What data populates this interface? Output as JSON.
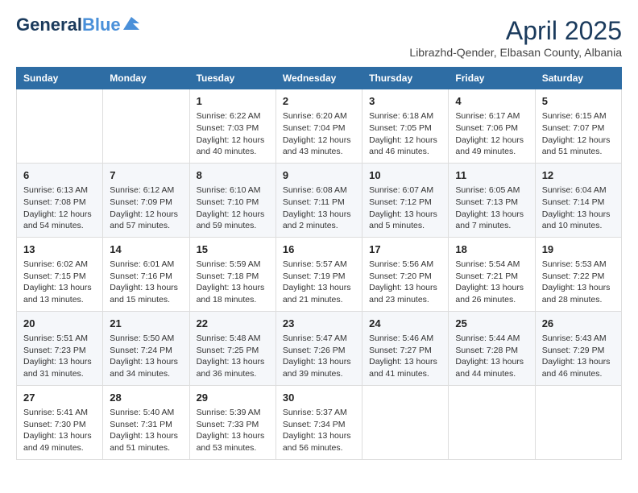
{
  "header": {
    "logo_general": "General",
    "logo_blue": "Blue",
    "month_year": "April 2025",
    "location": "Librazhd-Qender, Elbasan County, Albania"
  },
  "days_of_week": [
    "Sunday",
    "Monday",
    "Tuesday",
    "Wednesday",
    "Thursday",
    "Friday",
    "Saturday"
  ],
  "weeks": [
    [
      {
        "day": "",
        "content": ""
      },
      {
        "day": "",
        "content": ""
      },
      {
        "day": "1",
        "content": "Sunrise: 6:22 AM\nSunset: 7:03 PM\nDaylight: 12 hours and 40 minutes."
      },
      {
        "day": "2",
        "content": "Sunrise: 6:20 AM\nSunset: 7:04 PM\nDaylight: 12 hours and 43 minutes."
      },
      {
        "day": "3",
        "content": "Sunrise: 6:18 AM\nSunset: 7:05 PM\nDaylight: 12 hours and 46 minutes."
      },
      {
        "day": "4",
        "content": "Sunrise: 6:17 AM\nSunset: 7:06 PM\nDaylight: 12 hours and 49 minutes."
      },
      {
        "day": "5",
        "content": "Sunrise: 6:15 AM\nSunset: 7:07 PM\nDaylight: 12 hours and 51 minutes."
      }
    ],
    [
      {
        "day": "6",
        "content": "Sunrise: 6:13 AM\nSunset: 7:08 PM\nDaylight: 12 hours and 54 minutes."
      },
      {
        "day": "7",
        "content": "Sunrise: 6:12 AM\nSunset: 7:09 PM\nDaylight: 12 hours and 57 minutes."
      },
      {
        "day": "8",
        "content": "Sunrise: 6:10 AM\nSunset: 7:10 PM\nDaylight: 12 hours and 59 minutes."
      },
      {
        "day": "9",
        "content": "Sunrise: 6:08 AM\nSunset: 7:11 PM\nDaylight: 13 hours and 2 minutes."
      },
      {
        "day": "10",
        "content": "Sunrise: 6:07 AM\nSunset: 7:12 PM\nDaylight: 13 hours and 5 minutes."
      },
      {
        "day": "11",
        "content": "Sunrise: 6:05 AM\nSunset: 7:13 PM\nDaylight: 13 hours and 7 minutes."
      },
      {
        "day": "12",
        "content": "Sunrise: 6:04 AM\nSunset: 7:14 PM\nDaylight: 13 hours and 10 minutes."
      }
    ],
    [
      {
        "day": "13",
        "content": "Sunrise: 6:02 AM\nSunset: 7:15 PM\nDaylight: 13 hours and 13 minutes."
      },
      {
        "day": "14",
        "content": "Sunrise: 6:01 AM\nSunset: 7:16 PM\nDaylight: 13 hours and 15 minutes."
      },
      {
        "day": "15",
        "content": "Sunrise: 5:59 AM\nSunset: 7:18 PM\nDaylight: 13 hours and 18 minutes."
      },
      {
        "day": "16",
        "content": "Sunrise: 5:57 AM\nSunset: 7:19 PM\nDaylight: 13 hours and 21 minutes."
      },
      {
        "day": "17",
        "content": "Sunrise: 5:56 AM\nSunset: 7:20 PM\nDaylight: 13 hours and 23 minutes."
      },
      {
        "day": "18",
        "content": "Sunrise: 5:54 AM\nSunset: 7:21 PM\nDaylight: 13 hours and 26 minutes."
      },
      {
        "day": "19",
        "content": "Sunrise: 5:53 AM\nSunset: 7:22 PM\nDaylight: 13 hours and 28 minutes."
      }
    ],
    [
      {
        "day": "20",
        "content": "Sunrise: 5:51 AM\nSunset: 7:23 PM\nDaylight: 13 hours and 31 minutes."
      },
      {
        "day": "21",
        "content": "Sunrise: 5:50 AM\nSunset: 7:24 PM\nDaylight: 13 hours and 34 minutes."
      },
      {
        "day": "22",
        "content": "Sunrise: 5:48 AM\nSunset: 7:25 PM\nDaylight: 13 hours and 36 minutes."
      },
      {
        "day": "23",
        "content": "Sunrise: 5:47 AM\nSunset: 7:26 PM\nDaylight: 13 hours and 39 minutes."
      },
      {
        "day": "24",
        "content": "Sunrise: 5:46 AM\nSunset: 7:27 PM\nDaylight: 13 hours and 41 minutes."
      },
      {
        "day": "25",
        "content": "Sunrise: 5:44 AM\nSunset: 7:28 PM\nDaylight: 13 hours and 44 minutes."
      },
      {
        "day": "26",
        "content": "Sunrise: 5:43 AM\nSunset: 7:29 PM\nDaylight: 13 hours and 46 minutes."
      }
    ],
    [
      {
        "day": "27",
        "content": "Sunrise: 5:41 AM\nSunset: 7:30 PM\nDaylight: 13 hours and 49 minutes."
      },
      {
        "day": "28",
        "content": "Sunrise: 5:40 AM\nSunset: 7:31 PM\nDaylight: 13 hours and 51 minutes."
      },
      {
        "day": "29",
        "content": "Sunrise: 5:39 AM\nSunset: 7:33 PM\nDaylight: 13 hours and 53 minutes."
      },
      {
        "day": "30",
        "content": "Sunrise: 5:37 AM\nSunset: 7:34 PM\nDaylight: 13 hours and 56 minutes."
      },
      {
        "day": "",
        "content": ""
      },
      {
        "day": "",
        "content": ""
      },
      {
        "day": "",
        "content": ""
      }
    ]
  ]
}
